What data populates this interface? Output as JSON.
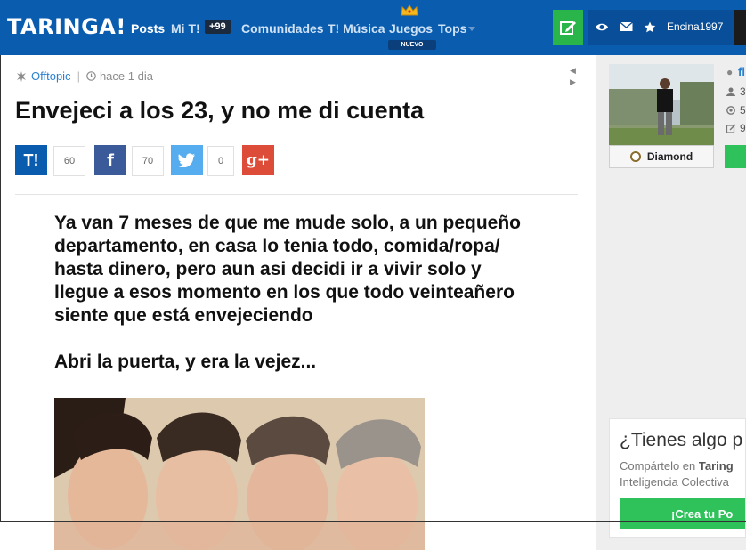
{
  "header": {
    "logo": "TARINGA!",
    "nav": [
      {
        "label": "Posts",
        "active": true
      },
      {
        "label": "Mi T!",
        "active": false
      },
      {
        "label": "Comunidades",
        "active": false
      },
      {
        "label": "T! Música",
        "active": false
      },
      {
        "label": "Juegos",
        "active": false
      },
      {
        "label": "Tops",
        "active": false
      }
    ],
    "notifications_badge": "+99",
    "juegos_badge": "NUEVO",
    "username": "Encina1997"
  },
  "post": {
    "category": "Offtopic",
    "time": "hace 1 dia",
    "title": "Envejeci a los 23, y no me di cuenta",
    "shares": [
      {
        "network": "taringa",
        "label": "T!",
        "count": "60",
        "color": "#0a5cae"
      },
      {
        "network": "facebook",
        "label": "f",
        "count": "70",
        "color": "#3b5a9a"
      },
      {
        "network": "twitter",
        "label": "",
        "count": "0",
        "color": "#55acee"
      },
      {
        "network": "google-plus",
        "label": "g+",
        "color": "#dd4b39"
      }
    ],
    "body_paragraph_1": "Ya van 7 meses de que me mude solo, a un pequeño departamento, en casa lo tenia todo, comida/ropa/ hasta dinero, pero aun asi decidi ir a vivir solo y llegue a esos momento en los que todo veinteañero siente que está envejeciendo",
    "body_paragraph_2": "Abri la puerta, y era la vejez..."
  },
  "sidebar": {
    "rank": "Diamond",
    "name_partial": "fl",
    "stats": [
      "3",
      "5",
      "9"
    ],
    "cta_title": "¿Tienes algo p",
    "cta_line1_prefix": "Compártelo en ",
    "cta_line1_bold": "Taring",
    "cta_line2": "Inteligencia Colectiva",
    "cta_button": "¡Crea tu Po"
  },
  "colors": {
    "header_bg": "#0a5cae",
    "user_area_bg": "#084e98",
    "accent_green": "#2fc15a",
    "link_blue": "#2a7fd0"
  }
}
